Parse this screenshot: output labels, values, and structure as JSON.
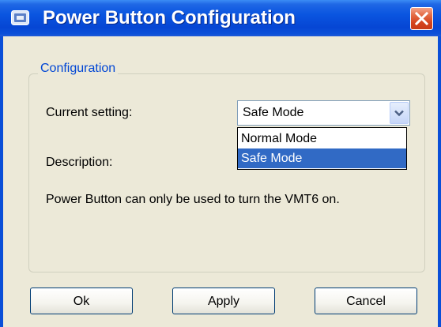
{
  "window": {
    "title": "Power Button Configuration",
    "app_icon": "monitor-icon",
    "close_icon": "close-icon"
  },
  "configuration": {
    "group_label": "Configuration",
    "current_setting_label": "Current setting:",
    "combo_value": "Safe Mode",
    "dropdown_options": [
      "Normal Mode",
      "Safe Mode"
    ],
    "selected_option": "Safe Mode",
    "description_label": "Description:",
    "description_text": "Power Button can only be used to turn the VMT6 on."
  },
  "buttons": {
    "ok": "Ok",
    "apply": "Apply",
    "cancel": "Cancel"
  },
  "colors": {
    "titlebar": "#0a55e0",
    "group_label": "#0046d5",
    "selection": "#316ac5",
    "close_button": "#d4431e",
    "background": "#ece9d8"
  }
}
